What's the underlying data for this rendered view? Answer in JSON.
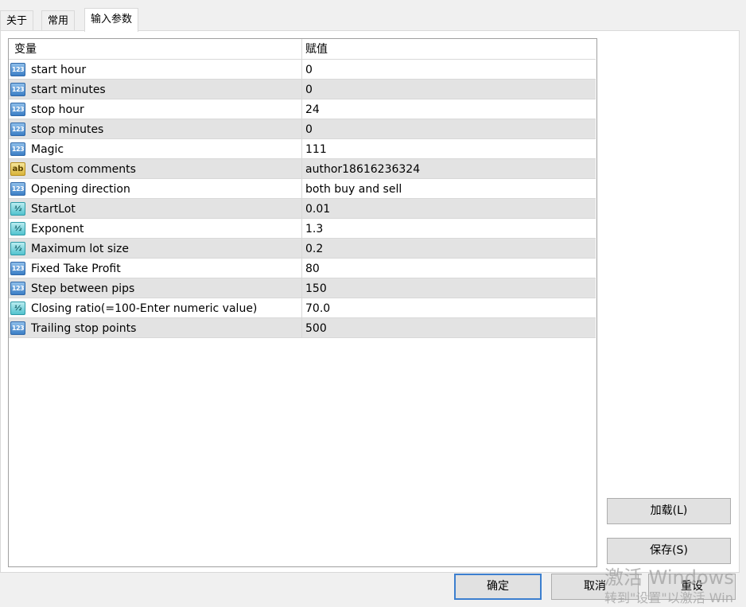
{
  "tabs": [
    {
      "label": "关于"
    },
    {
      "label": "常用"
    },
    {
      "label": "输入参数",
      "active": true
    }
  ],
  "table": {
    "headers": {
      "name": "变量",
      "value": "赋值"
    },
    "rows": [
      {
        "icon": "int-type-icon",
        "name": "start hour",
        "value": "0"
      },
      {
        "icon": "int-type-icon",
        "name": "start minutes",
        "value": "0"
      },
      {
        "icon": "int-type-icon",
        "name": "stop hour",
        "value": "24"
      },
      {
        "icon": "int-type-icon",
        "name": "stop minutes",
        "value": "0"
      },
      {
        "icon": "int-type-icon",
        "name": "Magic",
        "value": "111"
      },
      {
        "icon": "string-type-icon",
        "name": "Custom comments",
        "value": "author18616236324"
      },
      {
        "icon": "int-type-icon",
        "name": "Opening direction",
        "value": "both buy and sell"
      },
      {
        "icon": "double-type-icon",
        "name": "StartLot",
        "value": "0.01"
      },
      {
        "icon": "double-type-icon",
        "name": "Exponent",
        "value": "1.3"
      },
      {
        "icon": "double-type-icon",
        "name": "Maximum lot size",
        "value": "0.2"
      },
      {
        "icon": "int-type-icon",
        "name": "Fixed Take Profit",
        "value": "80"
      },
      {
        "icon": "int-type-icon",
        "name": "Step between pips",
        "value": "150"
      },
      {
        "icon": "double-type-icon",
        "name": "Closing ratio(=100-Enter numeric value)",
        "value": "70.0"
      },
      {
        "icon": "int-type-icon",
        "name": "Trailing stop points",
        "value": "500"
      }
    ]
  },
  "icon_glyphs": {
    "int": "123",
    "string": "ab",
    "double": "½"
  },
  "buttons": {
    "load": "加载(L)",
    "save": "保存(S)",
    "ok": "确定",
    "cancel": "取消",
    "reset": "重设"
  },
  "watermark": {
    "line1": "激活 Windows",
    "line2": "转到\"设置\"以激活 Win"
  }
}
